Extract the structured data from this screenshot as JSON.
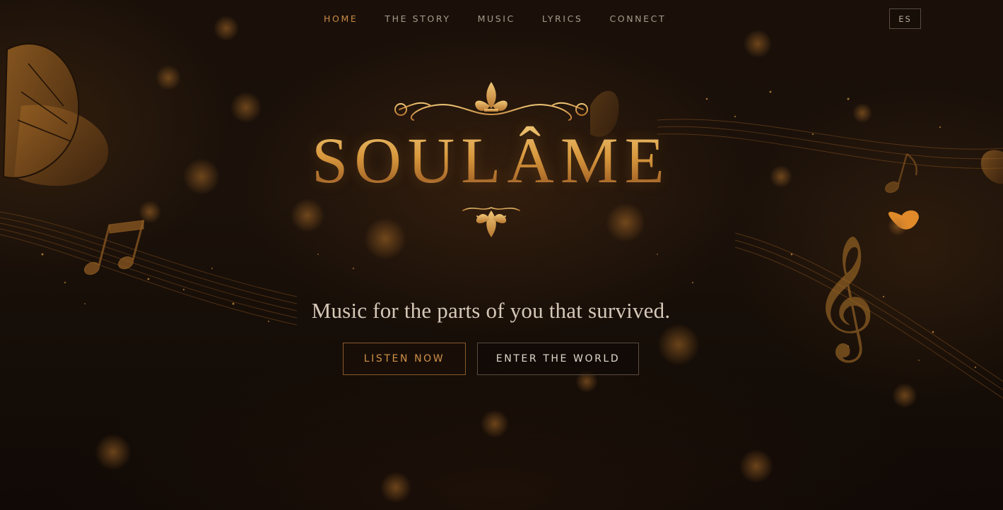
{
  "nav": {
    "items": [
      {
        "label": "HOME",
        "active": true
      },
      {
        "label": "THE STORY",
        "active": false
      },
      {
        "label": "MUSIC",
        "active": false
      },
      {
        "label": "LYRICS",
        "active": false
      },
      {
        "label": "CONNECT",
        "active": false
      }
    ],
    "language_label": "ES"
  },
  "hero": {
    "logo_text": "SOULÂME",
    "tagline": "Music for the parts of you that survived.",
    "primary_button": "LISTEN NOW",
    "secondary_button": "ENTER THE WORLD"
  },
  "decor": {
    "icons": [
      "butterfly-icon",
      "music-note-icon",
      "treble-clef-icon",
      "fleur-de-lis-icon"
    ]
  },
  "colors": {
    "background": "#120b07",
    "accent_gold": "#d1914a",
    "nav_active": "#c98a45",
    "nav_text": "#a89a8c",
    "tagline_text": "#d6c8b8"
  }
}
